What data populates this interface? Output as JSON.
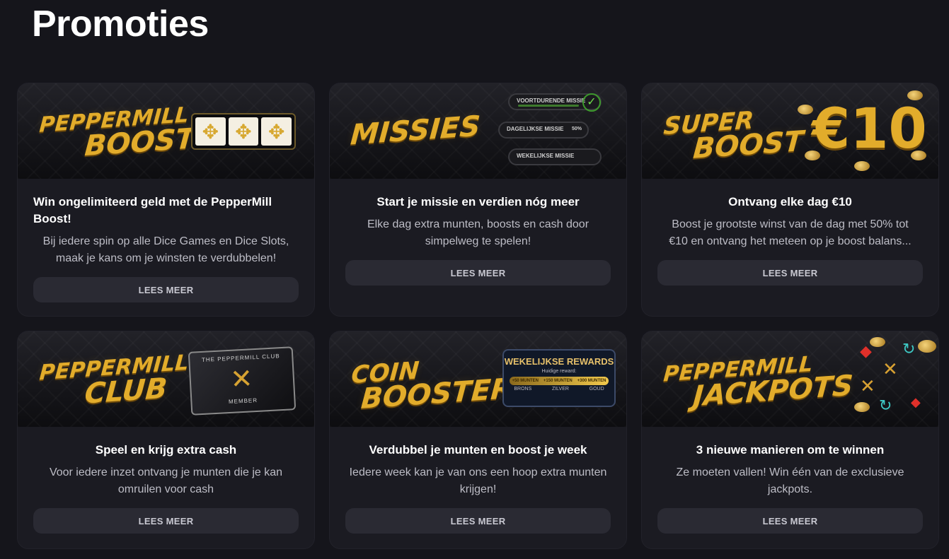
{
  "page": {
    "title": "Promoties"
  },
  "colors": {
    "background": "#15151b",
    "card": "#1b1b22",
    "gold": "#e2ac2b",
    "button": "#2a2a33"
  },
  "promotions": [
    {
      "banner": {
        "line1": "PEPPERMILL",
        "line2": "BOOST",
        "graphic": "dice-icon"
      },
      "heading": "Win ongelimiteerd geld met de PepperMill Boost!",
      "description": "Bij iedere spin op alle Dice Games en Dice Slots, maak je kans om je winsten te verdubbelen!",
      "button": "LEES MEER"
    },
    {
      "banner": {
        "line1": "MISSIES",
        "line2": "",
        "graphic": "mission-list-icon",
        "missions": [
          "VOORTDURENDE MISSIE",
          "DAGELIJKSE MISSIE",
          "WEKELIJKSE MISSIE"
        ],
        "progress": "50%"
      },
      "heading": "Start je missie en verdien nóg meer",
      "description": "Elke dag extra munten, boosts en cash door simpelweg te spelen!",
      "button": "LEES MEER"
    },
    {
      "banner": {
        "line1": "SUPER",
        "line2": "BOOST",
        "amount": "€10",
        "graphic": "coins-icon"
      },
      "heading": "Ontvang elke dag €10",
      "description_line1": "Boost je grootste winst van de dag met 50% tot",
      "description_line2": "€10 en ontvang het meteen op je boost balans...",
      "button": "LEES MEER"
    },
    {
      "banner": {
        "line1": "PEPPERMILL",
        "line2": "CLUB",
        "card_top": "THE PEPPERMILL CLUB",
        "card_bottom": "MEMBER",
        "graphic": "windmill-icon"
      },
      "heading": "Speel en krijg extra cash",
      "description": "Voor iedere inzet ontvang je munten die je kan omruilen voor cash",
      "button": "LEES MEER"
    },
    {
      "banner": {
        "line1": "COIN",
        "line2": "BOOSTER",
        "rewards_title": "WEKELIJKSE REWARDS",
        "rewards_sub": "Huidige reward:",
        "rewards_values": [
          "+50 MUNTEN",
          "+150 MUNTEN",
          "+300 MUNTEN"
        ],
        "rewards_levels": [
          "BRONS",
          "ZILVER",
          "GOUD"
        ],
        "graphic": "trophy-icon"
      },
      "heading": "Verdubbel je munten en boost je week",
      "description": "Iedere week kan je van ons een hoop extra munten krijgen!",
      "button": "LEES MEER"
    },
    {
      "banner": {
        "line1": "PEPPERMILL",
        "line2": "JACKPOTS",
        "graphic": "gems-icon"
      },
      "heading": "3 nieuwe manieren om te winnen",
      "description": "Ze moeten vallen! Win één van de exclusieve jackpots.",
      "button": "LEES MEER"
    }
  ]
}
